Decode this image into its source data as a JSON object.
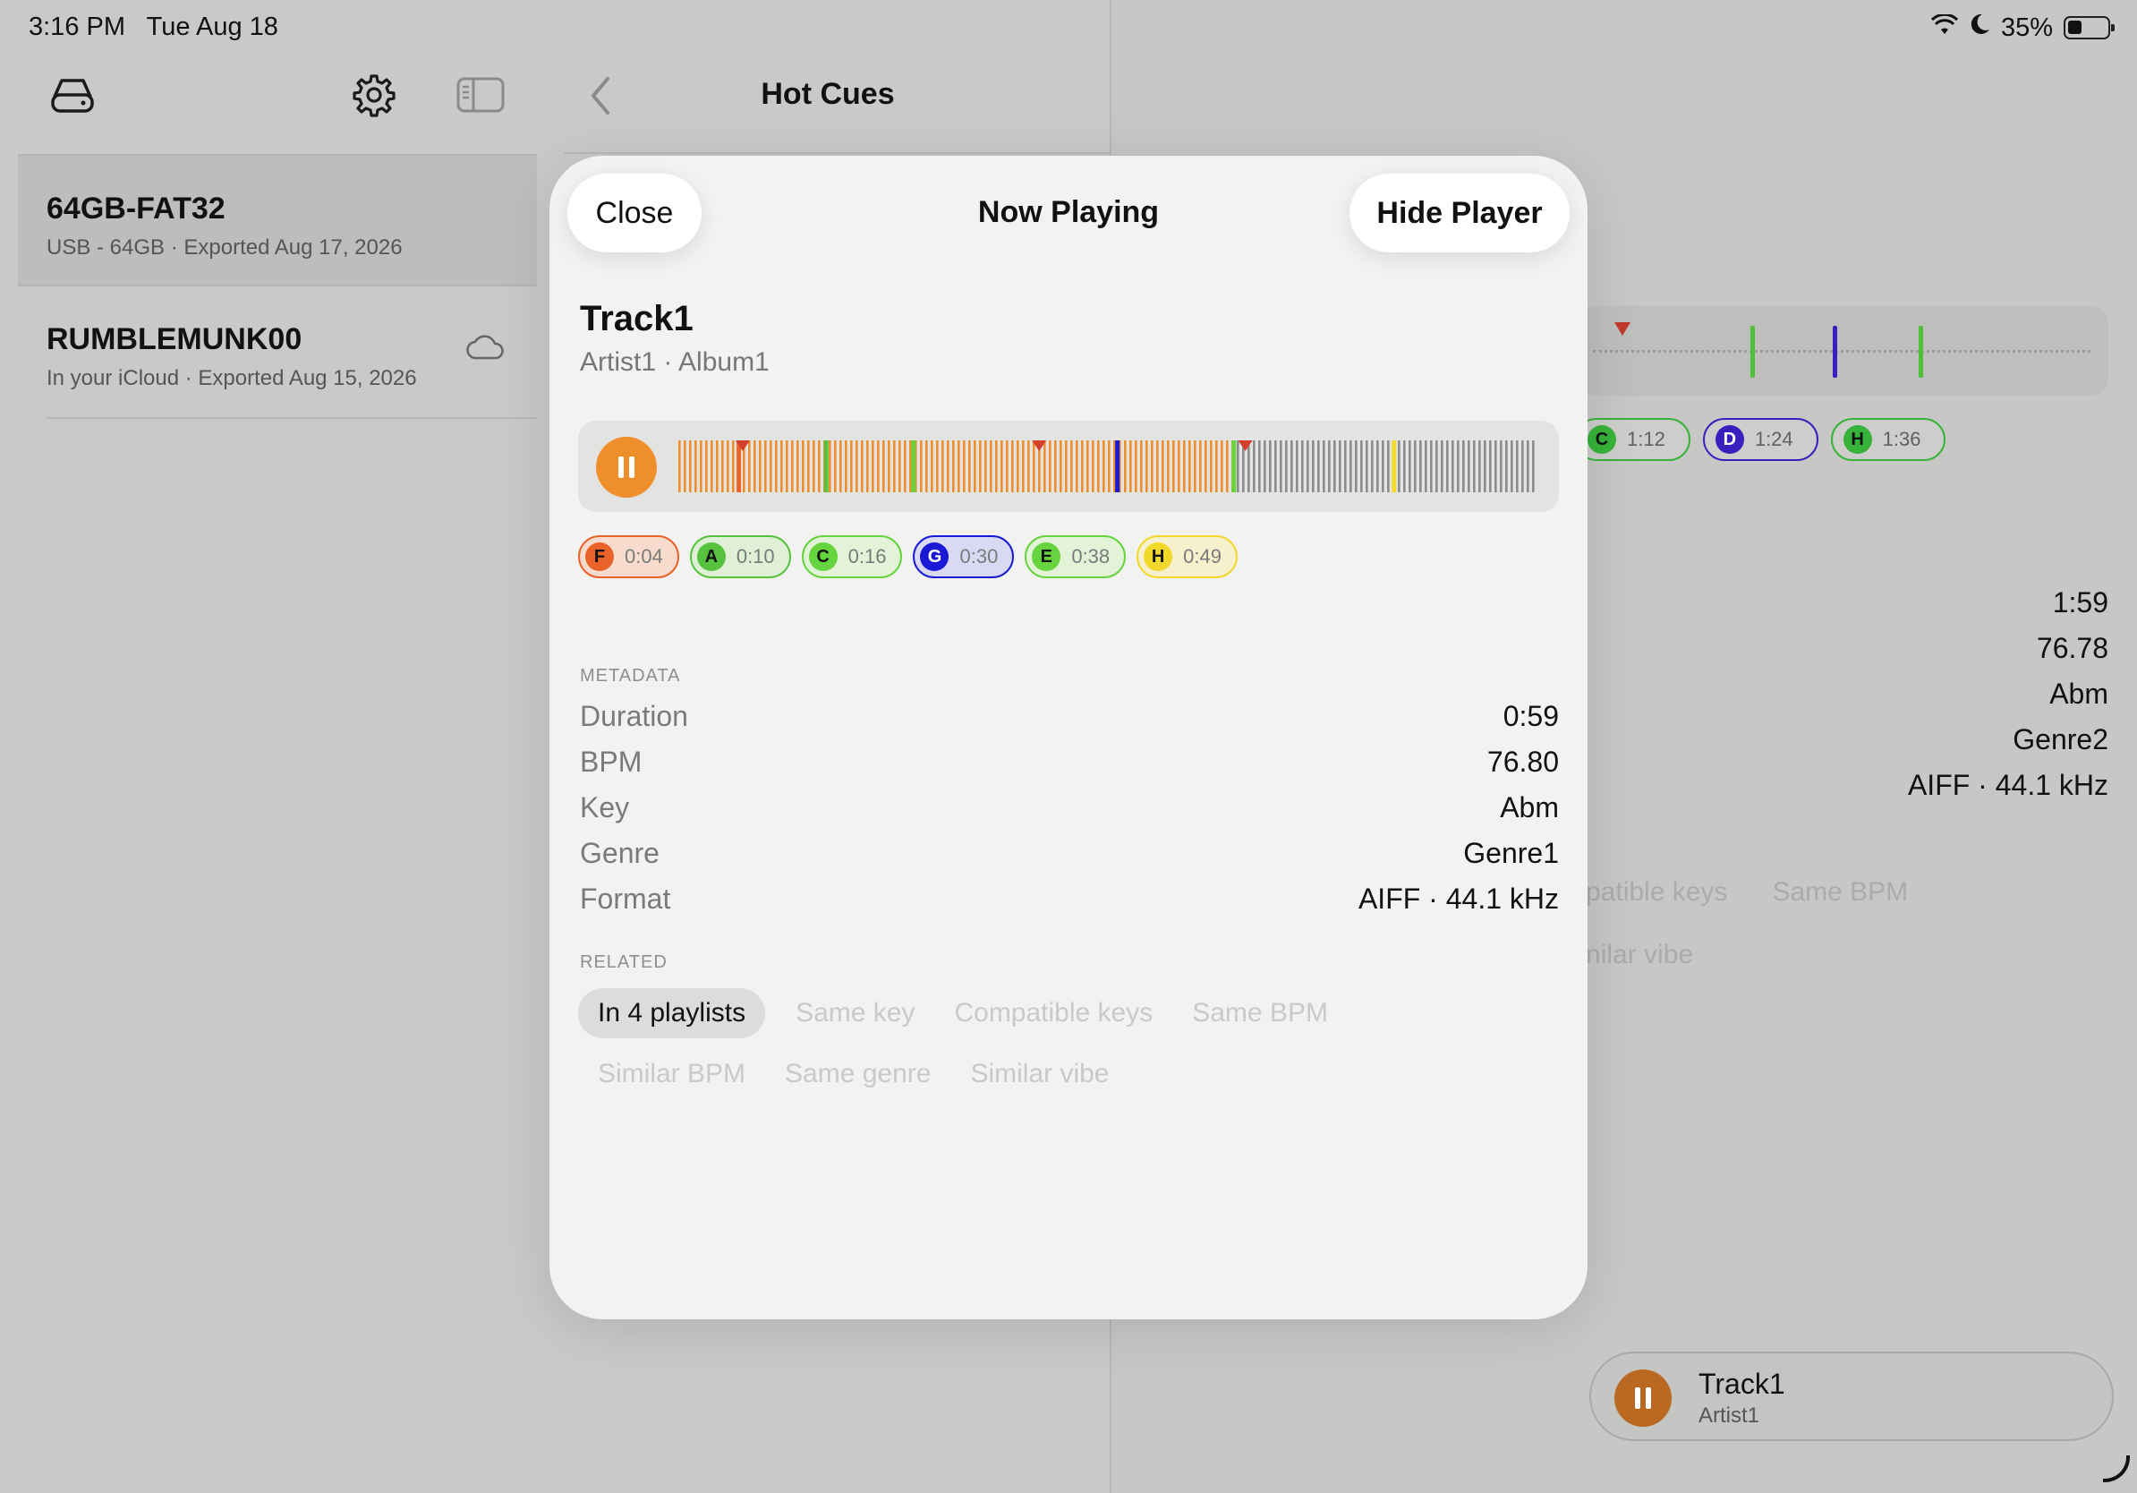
{
  "status": {
    "time": "3:16 PM",
    "date": "Tue Aug 18",
    "battery": "35%"
  },
  "nav": {
    "title": "Hot Cues"
  },
  "devices": [
    {
      "name": "64GB-FAT32",
      "detail": "USB - 64GB · Exported Aug 17, 2026",
      "selected": true
    },
    {
      "name": "RUMBLEMUNK00",
      "detail": "In your iCloud · Exported Aug 15, 2026",
      "cloud": true
    }
  ],
  "background_detail": {
    "cues": [
      {
        "letter": "C",
        "time": "1:12",
        "color": "#37b33a"
      },
      {
        "letter": "D",
        "time": "1:24",
        "color": "#3a1fbf"
      },
      {
        "letter": "H",
        "time": "1:36",
        "color": "#37b33a"
      }
    ],
    "metadata_values": [
      "1:59",
      "76.78",
      "Abm",
      "Genre2",
      "AIFF · 44.1 kHz"
    ],
    "related_visible": [
      "patible keys",
      "Same BPM"
    ],
    "related_visible2": [
      "nilar vibe"
    ]
  },
  "mini_player": {
    "title": "Track1",
    "artist": "Artist1"
  },
  "sheet": {
    "close_label": "Close",
    "title": "Now Playing",
    "hide_label": "Hide Player",
    "track_title": "Track1",
    "track_subtitle": "Artist1 · Album1",
    "playback_progress": 0.65,
    "cues": [
      {
        "letter": "F",
        "time": "0:04",
        "color": "#e8622a",
        "bg": "#f7dccd"
      },
      {
        "letter": "A",
        "time": "0:10",
        "color": "#57c23e",
        "bg": "#dff0d6"
      },
      {
        "letter": "C",
        "time": "0:16",
        "color": "#66d43f",
        "bg": "#e2f3d7"
      },
      {
        "letter": "G",
        "time": "0:30",
        "color": "#1a1ad6",
        "bg": "#d9d9f3"
      },
      {
        "letter": "E",
        "time": "0:38",
        "color": "#66d43f",
        "bg": "#e2f3d7"
      },
      {
        "letter": "H",
        "time": "0:49",
        "color": "#f2d82a",
        "bg": "#f6f0cc"
      }
    ],
    "metadata_label": "METADATA",
    "metadata": [
      {
        "key": "Duration",
        "value": "0:59"
      },
      {
        "key": "BPM",
        "value": "76.80"
      },
      {
        "key": "Key",
        "value": "Abm"
      },
      {
        "key": "Genre",
        "value": "Genre1"
      },
      {
        "key": "Format",
        "value": "AIFF · 44.1 kHz"
      }
    ],
    "related_label": "RELATED",
    "related_row1": [
      {
        "label": "In 4 playlists",
        "active": true
      },
      {
        "label": "Same key"
      },
      {
        "label": "Compatible keys"
      },
      {
        "label": "Same BPM"
      }
    ],
    "related_row2": [
      {
        "label": "Similar BPM"
      },
      {
        "label": "Same genre"
      },
      {
        "label": "Similar vibe"
      }
    ]
  },
  "colors": {
    "accent": "#ee8f2c",
    "played": "#ee8f2c",
    "unplayed": "#8c8c8c"
  }
}
